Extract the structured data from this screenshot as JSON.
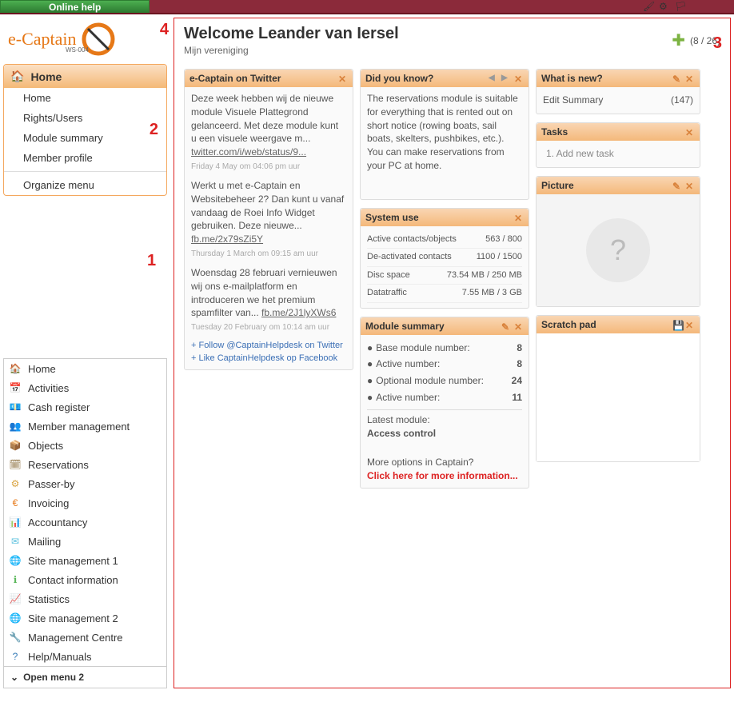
{
  "topbar": {
    "help": "Online help"
  },
  "logo": {
    "text": "e-Captain",
    "sub": "WS-004"
  },
  "annotations": {
    "a1": "1",
    "a2": "2",
    "a3": "3",
    "a4": "4"
  },
  "home_menu": {
    "title": "Home",
    "items": [
      "Home",
      "Rights/Users",
      "Module summary",
      "Member profile"
    ],
    "organize": "Organize menu"
  },
  "main_nav": [
    {
      "label": "Home",
      "icon": "🏠",
      "color": "#e67817"
    },
    {
      "label": "Activities",
      "icon": "📅",
      "color": "#d9534f"
    },
    {
      "label": "Cash register",
      "icon": "💶",
      "color": "#5cb85c"
    },
    {
      "label": "Member management",
      "icon": "👥",
      "color": "#5bc0de"
    },
    {
      "label": "Objects",
      "icon": "📦",
      "color": "#c09050"
    },
    {
      "label": "Reservations",
      "icon": "🗓",
      "color": "#8a6d3b"
    },
    {
      "label": "Passer-by",
      "icon": "⚙",
      "color": "#d9a441"
    },
    {
      "label": "Invoicing",
      "icon": "€",
      "color": "#e67817"
    },
    {
      "label": "Accountancy",
      "icon": "📊",
      "color": "#777"
    },
    {
      "label": "Mailing",
      "icon": "✉",
      "color": "#5bc0de"
    },
    {
      "label": "Site management 1",
      "icon": "🌐",
      "color": "#337ab7"
    },
    {
      "label": "Contact information",
      "icon": "ℹ",
      "color": "#5cb85c"
    },
    {
      "label": "Statistics",
      "icon": "📈",
      "color": "#d9534f"
    },
    {
      "label": "Site management 2",
      "icon": "🌐",
      "color": "#337ab7"
    },
    {
      "label": "Management Centre",
      "icon": "🔧",
      "color": "#999"
    },
    {
      "label": "Help/Manuals",
      "icon": "?",
      "color": "#337ab7"
    }
  ],
  "open_menu": "Open menu 2",
  "welcome": {
    "title": "Welcome Leander van Iersel",
    "sub": "Mijn vereniging",
    "count": "(8 / 26)"
  },
  "twitter": {
    "title": "e-Captain on Twitter",
    "tweets": [
      {
        "text": "Deze week hebben wij de nieuwe module Visuele Plattegrond gelanceerd. Met deze module kunt u een visuele weergave m...",
        "link": "twitter.com/i/web/status/9...",
        "time": "Friday 4 May om 04:06 pm uur"
      },
      {
        "text": "Werkt u met e-Captain en Websitebeheer 2? Dan kunt u vanaf vandaag de Roei Info Widget gebruiken. Deze nieuwe...",
        "link": "fb.me/2x79sZi5Y",
        "time": "Thursday 1 March om 09:15 am uur"
      },
      {
        "text": "Woensdag 28 februari vernieuwen wij ons e-mailplatform en introduceren we het premium spamfilter van...",
        "link": "fb.me/2J1lyXWs6",
        "time": "Tuesday 20 February om 10:14 am uur"
      }
    ],
    "follow": "+ Follow @CaptainHelpdesk on Twitter",
    "like": "+ Like CaptainHelpdesk op Facebook"
  },
  "didyouknow": {
    "title": "Did you know?",
    "body": "The reservations module is suitable for everything that is rented out on short notice (rowing boats, sail boats, skelters, pushbikes, etc.). You can make reservations from your PC at home."
  },
  "systemuse": {
    "title": "System use",
    "rows": [
      {
        "label": "Active contacts/objects",
        "value": "563 / 800"
      },
      {
        "label": "De-activated contacts",
        "value": "1100 / 1500"
      },
      {
        "label": "Disc space",
        "value": "73.54 MB / 250 MB"
      },
      {
        "label": "Datatraffic",
        "value": "7.55 MB / 3 GB"
      }
    ]
  },
  "modsummary": {
    "title": "Module summary",
    "rows": [
      {
        "label": "Base module number:",
        "value": "8"
      },
      {
        "label": "Active number:",
        "value": "8"
      },
      {
        "label": "Optional module number:",
        "value": "24"
      },
      {
        "label": "Active number:",
        "value": "11"
      }
    ],
    "latest_label": "Latest module:",
    "latest_value": "Access control",
    "more": "More options in Captain?",
    "click": "Click here for more information..."
  },
  "whatsnew": {
    "title": "What is new?",
    "rows": [
      {
        "label": "Edit Summary",
        "value": "(147)"
      }
    ]
  },
  "tasks": {
    "title": "Tasks",
    "row": "1.  Add new task"
  },
  "picture": {
    "title": "Picture"
  },
  "scratch": {
    "title": "Scratch pad"
  }
}
